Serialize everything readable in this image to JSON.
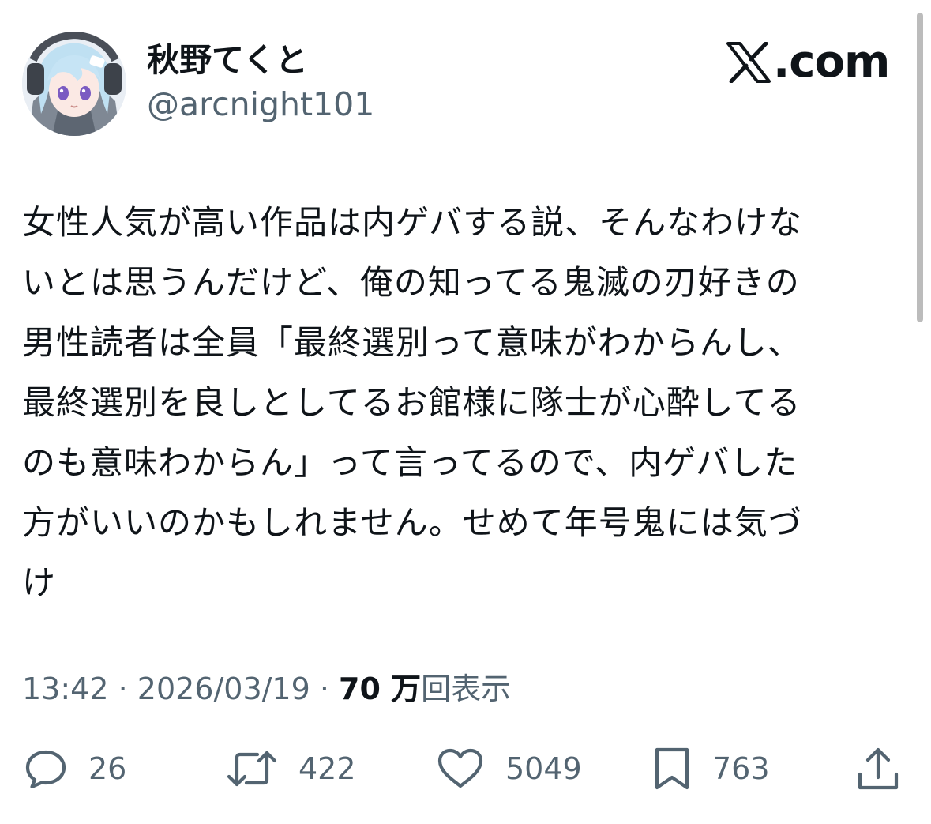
{
  "author": {
    "display_name": "秋野てくと",
    "handle": "@arcnight101",
    "avatar_icon": "avatar-anime-character-icon"
  },
  "brand": {
    "logo_icon": "x-logo-icon",
    "logo_text": ".com"
  },
  "tweet": {
    "lines": [
      "女性人気が高い作品は内ゲバする説、そんなわけな",
      "いとは思うんだけど、俺の知ってる鬼滅の刃好きの",
      "男性読者は全員「最終選別って意味がわからんし、",
      "最終選別を良しとしてるお館様に隊士が心酔してる",
      "のも意味わからん」って言ってるので、内ゲバした",
      "方がいいのかもしれません。せめて年号鬼には気づ",
      "け"
    ]
  },
  "meta": {
    "time": "13:42",
    "separator": " · ",
    "date": "2026/03/19",
    "views_count": "70 万",
    "views_label": "回表示"
  },
  "actions": {
    "reply_count": "26",
    "repost_count": "422",
    "like_count": "5049",
    "bookmark_count": "763"
  },
  "colors": {
    "text_primary": "#0f1419",
    "text_secondary": "#536471",
    "scrollbar": "#bcbcbc"
  }
}
